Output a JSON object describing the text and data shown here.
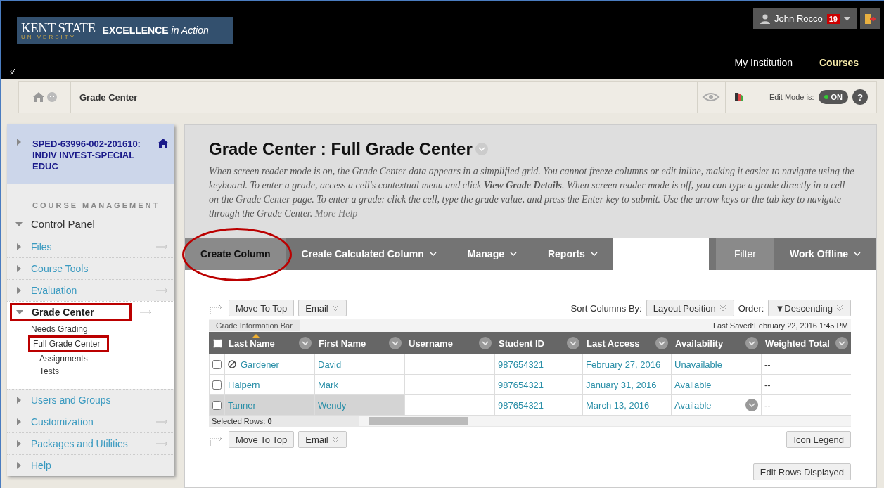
{
  "header": {
    "logo": {
      "name": "KENT STATE",
      "sub": "UNIVERSITY",
      "tagline": "EXCELLENCE",
      "tagline_italic": "in Action"
    },
    "user": {
      "name": "John Rocco",
      "notifications": "19"
    },
    "nav": [
      {
        "label": "My Institution",
        "selected": false
      },
      {
        "label": "Courses",
        "selected": true
      }
    ]
  },
  "breadcrumb": {
    "label": "Grade Center",
    "edit_mode_label": "Edit Mode is:",
    "edit_mode_value": "ON",
    "edit_mode_on": true,
    "help": "?"
  },
  "sidebar": {
    "course": "SPED-63996-002-201610: INDIV INVEST-SPECIAL EDUC",
    "section": "COURSE MANAGEMENT",
    "panel": {
      "label": "Control Panel",
      "expanded": true
    },
    "items": [
      {
        "label": "Files",
        "expanded": false,
        "highlighted": false,
        "quick_link": true
      },
      {
        "label": "Course Tools",
        "expanded": false,
        "highlighted": false,
        "quick_link": false
      },
      {
        "label": "Evaluation",
        "expanded": false,
        "highlighted": false,
        "quick_link": true
      },
      {
        "label": "Grade Center",
        "expanded": true,
        "highlighted": true,
        "quick_link": true,
        "children": [
          {
            "label": "Needs Grading",
            "highlighted": false
          },
          {
            "label": "Full Grade Center",
            "highlighted": true,
            "children": [
              {
                "label": "Assignments",
                "highlighted": false
              },
              {
                "label": "Tests",
                "highlighted": false
              }
            ]
          }
        ]
      },
      {
        "label": "Users and Groups",
        "expanded": false,
        "highlighted": false,
        "quick_link": false
      },
      {
        "label": "Customization",
        "expanded": false,
        "highlighted": false,
        "quick_link": true
      },
      {
        "label": "Packages and Utilities",
        "expanded": false,
        "highlighted": false,
        "quick_link": true
      },
      {
        "label": "Help",
        "expanded": false,
        "highlighted": false,
        "quick_link": false
      }
    ]
  },
  "page": {
    "title": "Grade Center : Full Grade Center",
    "description": "When screen reader mode is on, the Grade Center data appears in a simplified grid. You cannot freeze columns or edit inline, making it easier to navigate using the keyboard. To enter a grade, access a cell's contextual menu and click **View Grade Details**. When screen reader mode is off, you can type a grade directly in a cell on the Grade Center page. To enter a grade: click the cell, type the grade value, and press the Enter key to submit. Use the arrow keys or the tab key to navigate through the Grade Center.",
    "help_link": "More Help"
  },
  "toolbar": {
    "items": [
      {
        "label": "Create Column",
        "menu": false,
        "highlighted": true
      },
      {
        "label": "Create Calculated Column",
        "menu": true,
        "highlighted": false
      },
      {
        "label": "Manage",
        "menu": true,
        "highlighted": false
      },
      {
        "label": "Reports",
        "menu": true,
        "highlighted": false
      }
    ],
    "filter": "Filter",
    "work_offline": "Work Offline"
  },
  "grid": {
    "top_actions": [
      "Move To Top",
      "Email"
    ],
    "sort_label": "Sort Columns By:",
    "sort_value": "Layout Position",
    "order_label": "Order:",
    "order_value": "▼Descending",
    "all_checked": false,
    "info_bar": "Grade Information Bar",
    "last_saved": "Last Saved:February 22, 2016 1:45 PM",
    "columns": [
      {
        "label": "Last Name",
        "sorted": true
      },
      {
        "label": "First Name",
        "sorted": false
      },
      {
        "label": "Username",
        "sorted": false
      },
      {
        "label": "Student ID",
        "sorted": false
      },
      {
        "label": "Last Access",
        "sorted": false
      },
      {
        "label": "Availability",
        "sorted": false
      },
      {
        "label": "Weighted Total",
        "sorted": false
      }
    ],
    "rows": [
      {
        "checked": false,
        "blocked": true,
        "hovered": false,
        "cells": [
          "Gardener",
          "David",
          "",
          "987654321",
          "February 27, 2016",
          "Unavailable",
          "--"
        ]
      },
      {
        "checked": false,
        "blocked": false,
        "hovered": false,
        "cells": [
          "Halpern",
          "Mark",
          "",
          "987654321",
          "January 31, 2016",
          "Available",
          "--"
        ]
      },
      {
        "checked": false,
        "blocked": false,
        "hovered": true,
        "cells": [
          "Tanner",
          "Wendy",
          "",
          "987654321",
          "March 13, 2016",
          "Available",
          "--"
        ]
      }
    ],
    "selected_rows": "Selected Rows: **0**",
    "bottom_actions": [
      "Move To Top",
      "Email"
    ],
    "icon_legend": "Icon Legend",
    "edit_rows": "Edit Rows Displayed"
  }
}
